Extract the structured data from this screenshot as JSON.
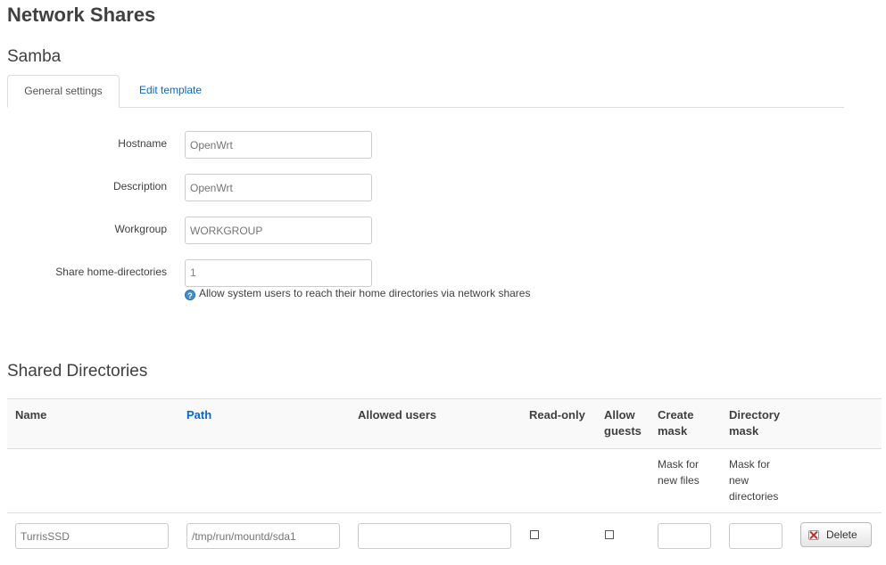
{
  "page": {
    "title": "Network Shares"
  },
  "section": {
    "title": "Samba"
  },
  "tabs": [
    {
      "label": "General settings",
      "active": true
    },
    {
      "label": "Edit template",
      "active": false
    }
  ],
  "general": {
    "hostname": {
      "label": "Hostname",
      "placeholder": "OpenWrt",
      "value": ""
    },
    "description": {
      "label": "Description",
      "placeholder": "OpenWrt",
      "value": ""
    },
    "workgroup": {
      "label": "Workgroup",
      "placeholder": "WORKGROUP",
      "value": ""
    },
    "homes": {
      "label": "Share home-directories",
      "value": "1",
      "help_icon": "help-icon",
      "help": "Allow system users to reach their home directories via network shares"
    }
  },
  "shares": {
    "title": "Shared Directories",
    "columns": [
      {
        "label": "Name"
      },
      {
        "label": "Path"
      },
      {
        "label": "Allowed users"
      },
      {
        "label": "Read-only"
      },
      {
        "label": "Allow guests"
      },
      {
        "label": "Create mask"
      },
      {
        "label": "Directory mask"
      }
    ],
    "descriptions": {
      "create_mask": "Mask for new files",
      "directory_mask": "Mask for new directories"
    },
    "rows": [
      {
        "name_placeholder": "TurrisSSD",
        "path_placeholder": "/tmp/run/mountd/sda1",
        "users": "",
        "read_only": false,
        "guest_ok": false,
        "create_mask": "",
        "dir_mask": "",
        "delete_label": "Delete"
      }
    ]
  },
  "colors": {
    "link": "#0069d6",
    "text": "#404040",
    "border": "#dddddd"
  }
}
